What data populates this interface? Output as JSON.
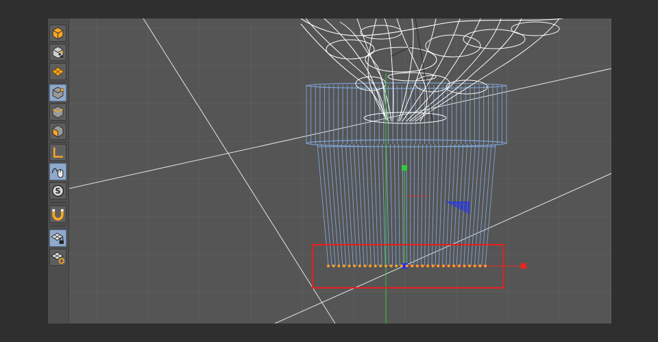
{
  "colors": {
    "background": "#2f2f2f",
    "viewport": "#555555",
    "grid_line": "#5d5d5d",
    "pot_wire": "#7fa6d8",
    "plant_wire": "#ffffff",
    "point_selection": "#f0a030",
    "selection_box": "#ee1c1c",
    "axis_y": "#2ecc40",
    "axis_x": "#ee2222",
    "axis_z": "#2233ee",
    "tool_active": "#8fa9cc",
    "icon_orange": "#f5a623"
  },
  "toolbar": {
    "tools": [
      {
        "name": "model-mode",
        "icon": "cube-icon",
        "active": true
      },
      {
        "name": "texture-mode",
        "icon": "checker-cube-icon",
        "active": false
      },
      {
        "name": "workplane-mode",
        "icon": "workplane-icon",
        "active": false
      },
      {
        "name": "points-mode",
        "icon": "points-cube-icon",
        "active": true
      },
      {
        "name": "edges-mode",
        "icon": "edges-cube-icon",
        "active": false
      },
      {
        "name": "polygons-mode",
        "icon": "polygons-cube-icon",
        "active": false
      },
      {
        "name": "axis-mode",
        "icon": "axis-icon",
        "active": false
      },
      {
        "name": "tweak-mode",
        "icon": "tweak-mouse-icon",
        "active": true
      },
      {
        "name": "solo-mode",
        "icon": "solo-icon",
        "active": false
      },
      {
        "name": "snap-toggle",
        "icon": "magnet-icon",
        "active": false
      },
      {
        "name": "workplane-lock",
        "icon": "workplane-lock-icon",
        "active": true
      },
      {
        "name": "workplane-locked",
        "icon": "workplane-locked-icon",
        "active": false
      }
    ]
  }
}
